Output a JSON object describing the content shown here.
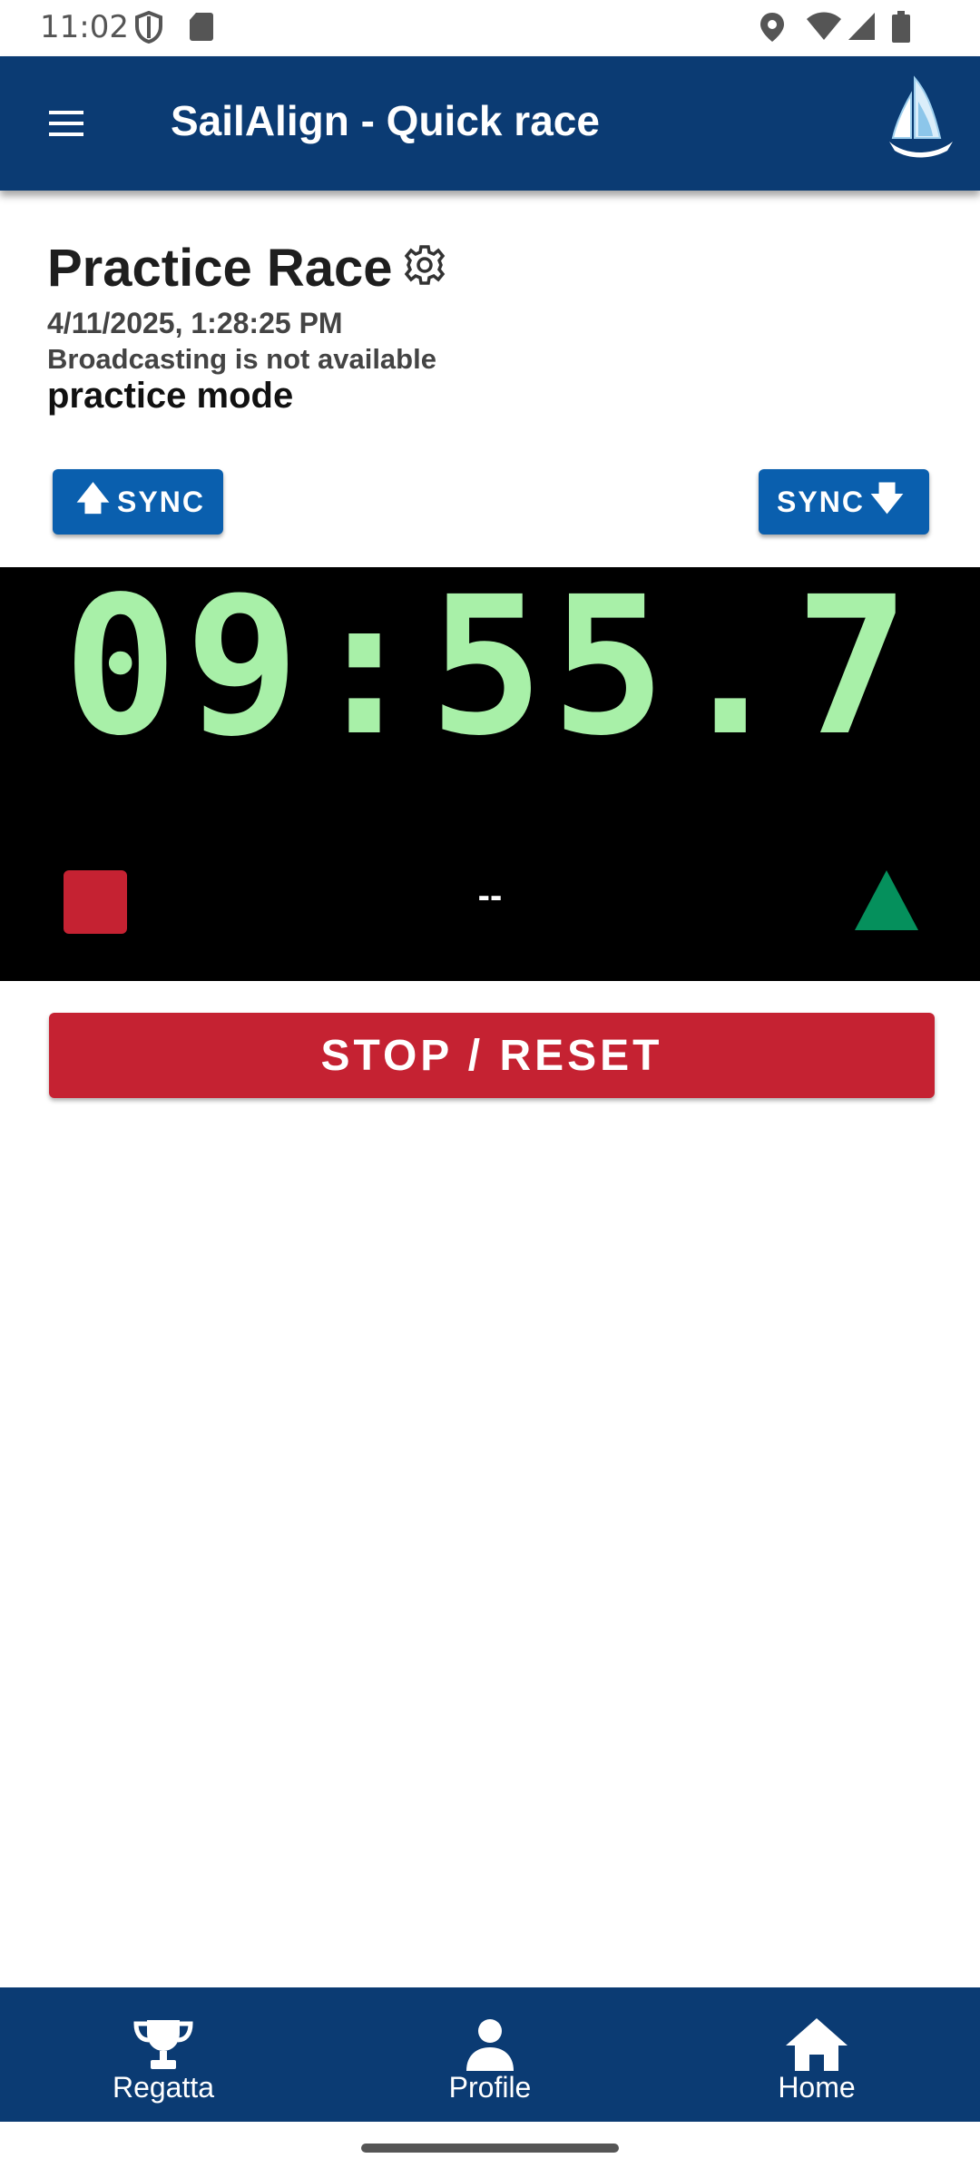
{
  "status_bar": {
    "time": "11:02",
    "icons": [
      "shield-icon",
      "sd-card-icon",
      "location-icon",
      "wifi-icon",
      "signal-icon",
      "battery-icon"
    ]
  },
  "app_bar": {
    "title": "SailAlign - Quick race",
    "menu_icon": "menu-icon",
    "logo_icon": "sailboat-logo-icon"
  },
  "race": {
    "title": "Practice Race",
    "datetime": "4/11/2025, 1:28:25 PM",
    "broadcast_status": "Broadcasting is not available",
    "mode": "practice mode"
  },
  "sync": {
    "left_label": "SYNC",
    "right_label": "SYNC"
  },
  "timer": {
    "display": "09:55.7",
    "center_text": "--"
  },
  "actions": {
    "reset_label": "STOP / RESET"
  },
  "bottom_nav": {
    "items": [
      {
        "label": "Regatta",
        "icon": "trophy-icon"
      },
      {
        "label": "Profile",
        "icon": "person-icon"
      },
      {
        "label": "Home",
        "icon": "home-icon"
      }
    ]
  },
  "colors": {
    "primary": "#0b3b73",
    "button_blue": "#0a5fae",
    "danger": "#c52232",
    "timer_green": "#a8f0a8",
    "start_green": "#05905c"
  }
}
